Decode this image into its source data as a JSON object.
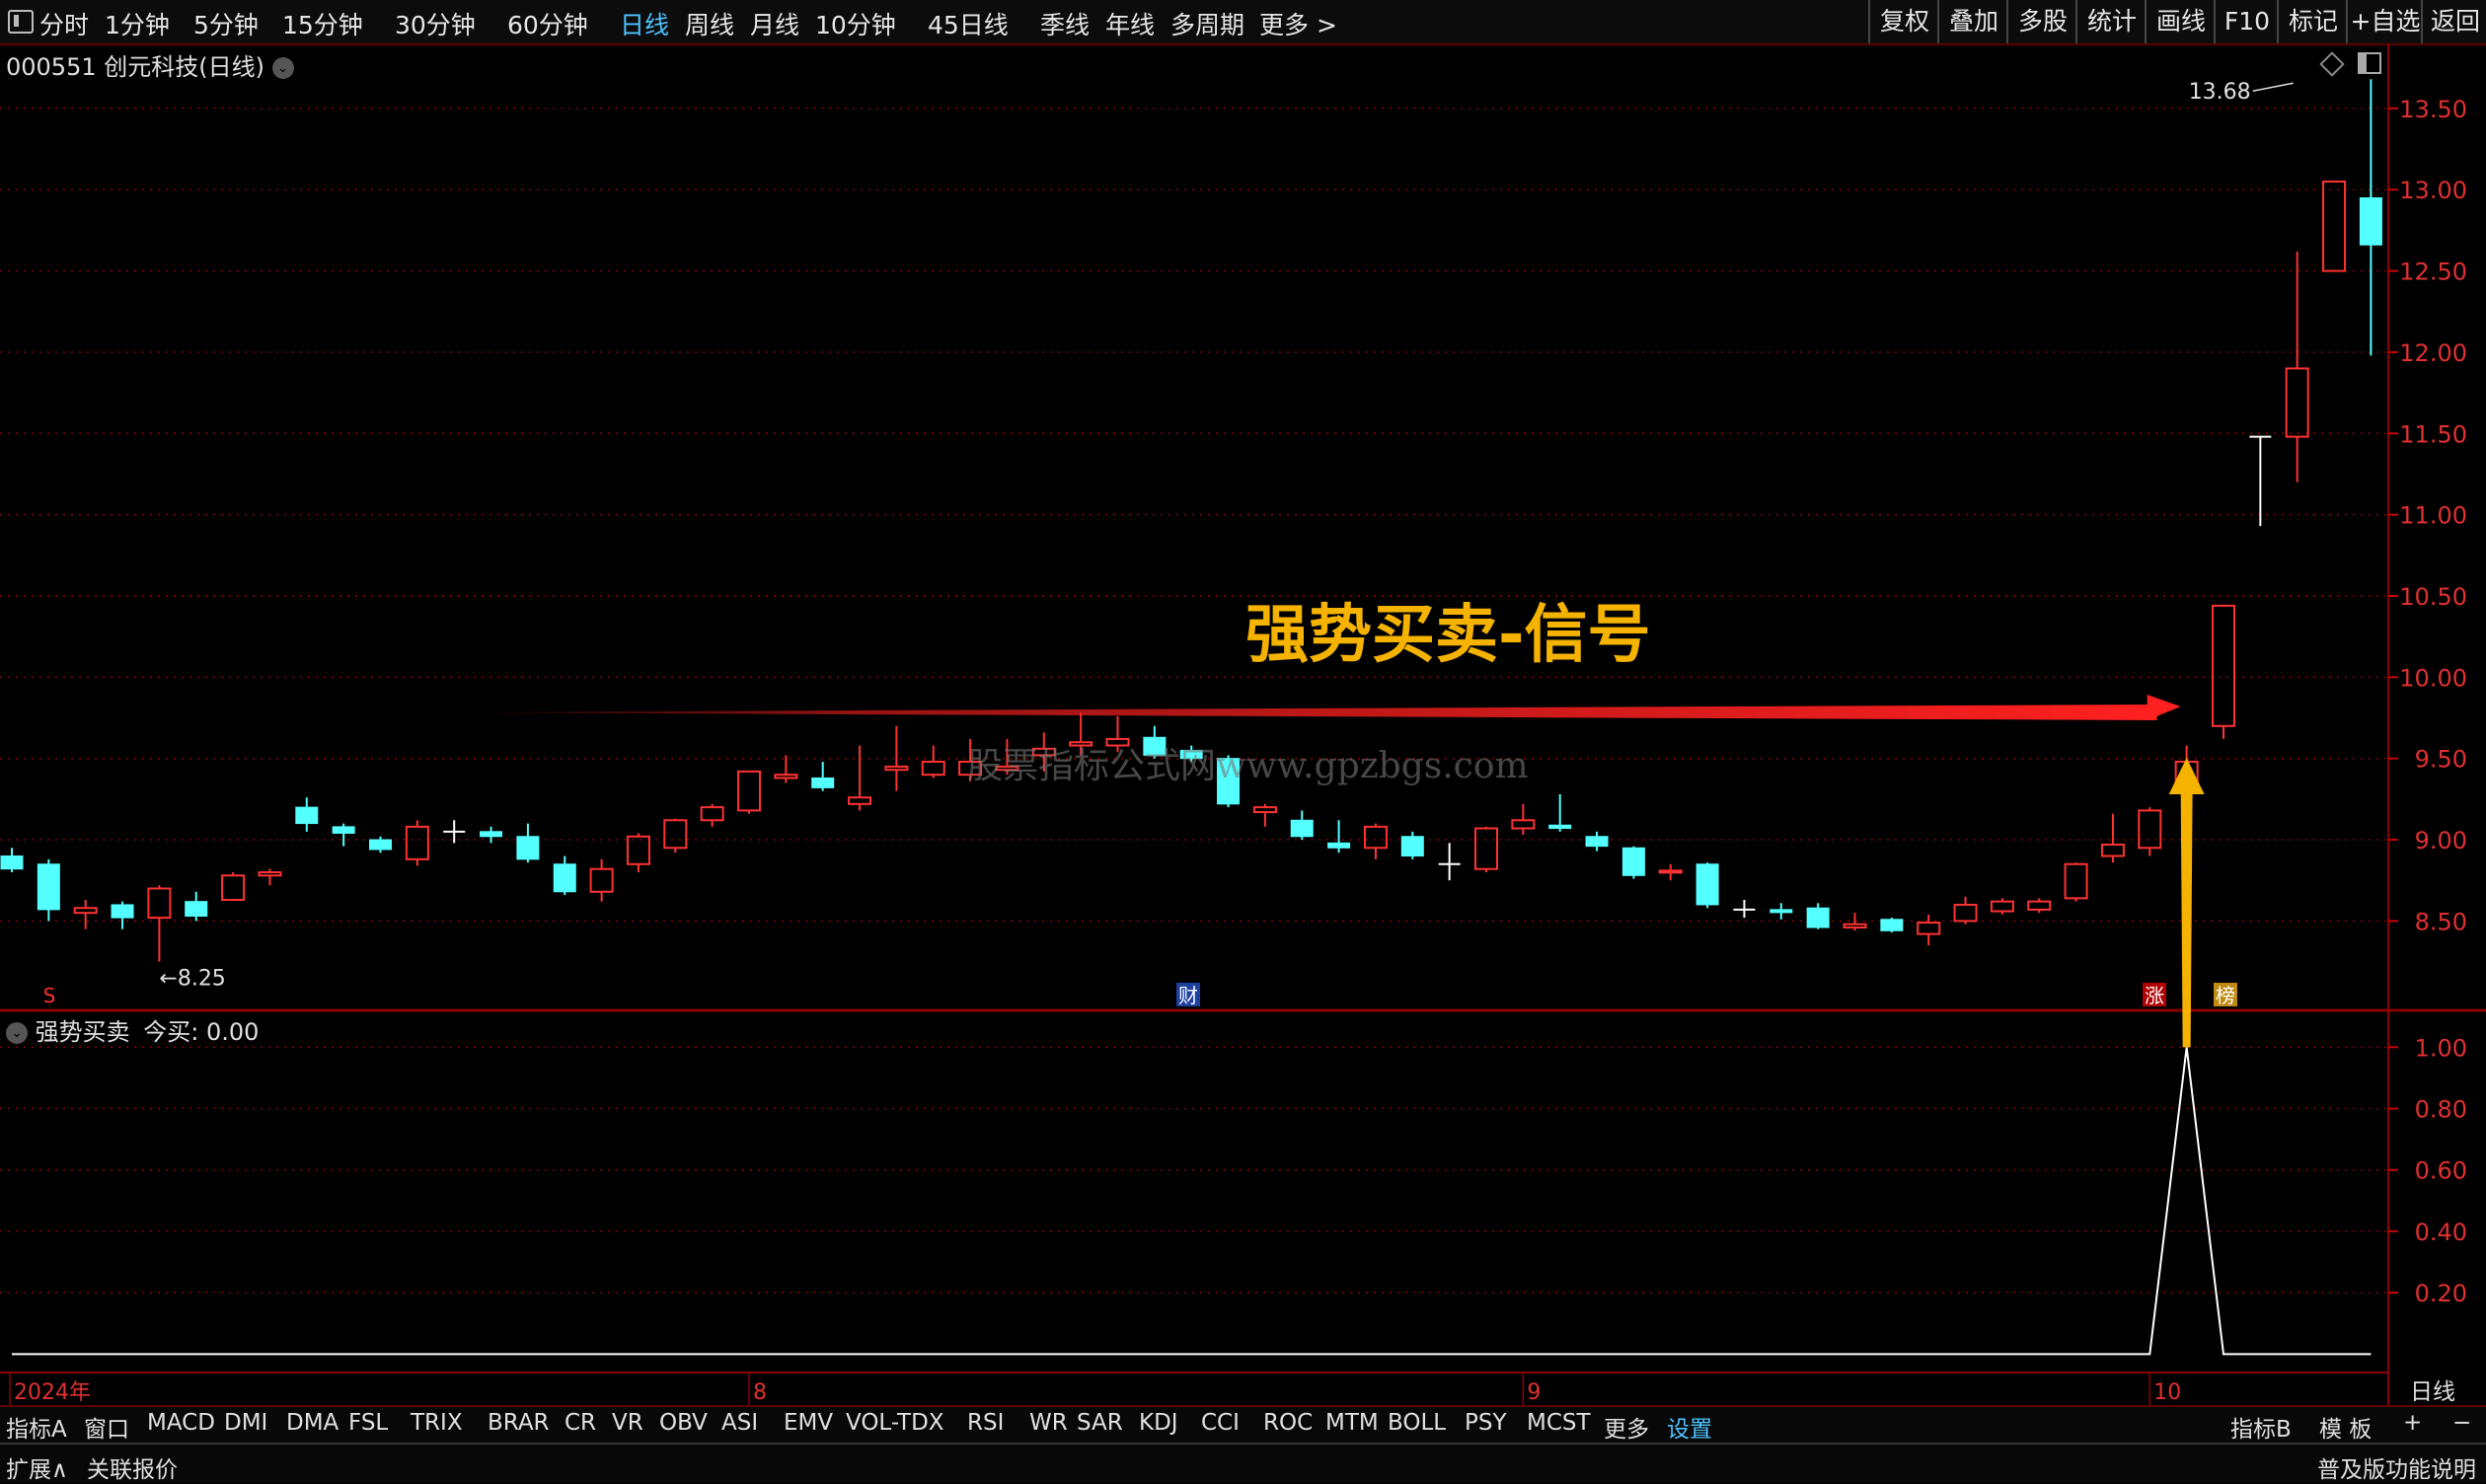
{
  "topbar": {
    "periods": [
      "分时",
      "1分钟",
      "5分钟",
      "15分钟",
      "30分钟",
      "60分钟",
      "日线",
      "周线",
      "月线",
      "10分钟",
      "45日线",
      "季线",
      "年线",
      "多周期",
      "更多 >"
    ],
    "active": "日线",
    "right_buttons": [
      "复权",
      "叠加",
      "多股",
      "统计",
      "画线",
      "F10",
      "标记",
      "+自选",
      "返回"
    ]
  },
  "stock": {
    "code": "000551",
    "name": "创元科技",
    "period": "(日线)"
  },
  "annotation": {
    "text": "强势买卖-信号",
    "watermark": "股票指标公式网www.gpzbgs.com"
  },
  "markers": {
    "fin": "财",
    "zhang": "涨",
    "bang": "榜",
    "s": "S"
  },
  "indicator": {
    "name": "强势买卖",
    "label": "今买: 0.00"
  },
  "bottom_tabs": [
    "指标A",
    "窗口",
    "MACD",
    "DMI",
    "DMA",
    "FSL",
    "TRIX",
    "BRAR",
    "CR",
    "VR",
    "OBV",
    "ASI",
    "EMV",
    "VOL-TDX",
    "RSI",
    "WR",
    "SAR",
    "KDJ",
    "CCI",
    "ROC",
    "MTM",
    "BOLL",
    "PSY",
    "MCST",
    "更多",
    "设置"
  ],
  "bottom_right": [
    "指标B",
    "模 板",
    "+",
    "−"
  ],
  "status": {
    "left1": "扩展∧",
    "left2": "关联报价",
    "right": "普及版功能说明",
    "period_label": "日线"
  },
  "chart_data": [
    {
      "type": "candlestick",
      "title": "",
      "y_ticks": [
        8.5,
        9.0,
        9.5,
        10.0,
        10.5,
        11.0,
        11.5,
        12.0,
        12.5,
        13.0,
        13.5
      ],
      "ylim": [
        7.95,
        13.9
      ],
      "x_labels": [
        {
          "text": "2024年",
          "index": 0
        },
        {
          "text": "8",
          "index": 20
        },
        {
          "text": "9",
          "index": 41
        },
        {
          "text": "10",
          "index": 58
        }
      ],
      "low_label": {
        "text": "←8.25",
        "value": 8.25,
        "index": 4
      },
      "high_label": {
        "text": "13.68",
        "value": 13.68,
        "index": 62
      },
      "candles": [
        {
          "o": 8.9,
          "c": 8.82,
          "h": 8.95,
          "l": 8.8
        },
        {
          "o": 8.85,
          "c": 8.57,
          "h": 8.88,
          "l": 8.5
        },
        {
          "o": 8.55,
          "c": 8.58,
          "h": 8.63,
          "l": 8.45
        },
        {
          "o": 8.6,
          "c": 8.52,
          "h": 8.62,
          "l": 8.45
        },
        {
          "o": 8.52,
          "c": 8.7,
          "h": 8.72,
          "l": 8.25
        },
        {
          "o": 8.62,
          "c": 8.53,
          "h": 8.68,
          "l": 8.5
        },
        {
          "o": 8.63,
          "c": 8.78,
          "h": 8.8,
          "l": 8.63
        },
        {
          "o": 8.78,
          "c": 8.8,
          "h": 8.82,
          "l": 8.72
        },
        {
          "o": 9.2,
          "c": 9.1,
          "h": 9.26,
          "l": 9.05
        },
        {
          "o": 9.08,
          "c": 9.04,
          "h": 9.1,
          "l": 8.96
        },
        {
          "o": 9.0,
          "c": 8.94,
          "h": 9.02,
          "l": 8.92
        },
        {
          "o": 8.88,
          "c": 9.08,
          "h": 9.12,
          "l": 8.84
        },
        {
          "o": 9.05,
          "c": 9.05,
          "h": 9.12,
          "l": 8.98
        },
        {
          "o": 9.05,
          "c": 9.02,
          "h": 9.08,
          "l": 8.98
        },
        {
          "o": 9.02,
          "c": 8.88,
          "h": 9.1,
          "l": 8.86
        },
        {
          "o": 8.85,
          "c": 8.68,
          "h": 8.9,
          "l": 8.66
        },
        {
          "o": 8.68,
          "c": 8.82,
          "h": 8.88,
          "l": 8.62
        },
        {
          "o": 8.85,
          "c": 9.02,
          "h": 9.04,
          "l": 8.8
        },
        {
          "o": 8.95,
          "c": 9.12,
          "h": 9.13,
          "l": 8.92
        },
        {
          "o": 9.12,
          "c": 9.2,
          "h": 9.22,
          "l": 9.08
        },
        {
          "o": 9.18,
          "c": 9.42,
          "h": 9.42,
          "l": 9.16
        },
        {
          "o": 9.38,
          "c": 9.4,
          "h": 9.52,
          "l": 9.35
        },
        {
          "o": 9.38,
          "c": 9.32,
          "h": 9.48,
          "l": 9.3
        },
        {
          "o": 9.22,
          "c": 9.26,
          "h": 9.58,
          "l": 9.18
        },
        {
          "o": 9.43,
          "c": 9.45,
          "h": 9.7,
          "l": 9.3
        },
        {
          "o": 9.4,
          "c": 9.48,
          "h": 9.58,
          "l": 9.38
        },
        {
          "o": 9.4,
          "c": 9.48,
          "h": 9.62,
          "l": 9.36
        },
        {
          "o": 9.43,
          "c": 9.45,
          "h": 9.62,
          "l": 9.4
        },
        {
          "o": 9.52,
          "c": 9.56,
          "h": 9.66,
          "l": 9.42
        },
        {
          "o": 9.58,
          "c": 9.6,
          "h": 9.78,
          "l": 9.52
        },
        {
          "o": 9.58,
          "c": 9.62,
          "h": 9.76,
          "l": 9.54
        },
        {
          "o": 9.63,
          "c": 9.52,
          "h": 9.7,
          "l": 9.5
        },
        {
          "o": 9.55,
          "c": 9.5,
          "h": 9.58,
          "l": 9.48
        },
        {
          "o": 9.5,
          "c": 9.22,
          "h": 9.52,
          "l": 9.2
        },
        {
          "o": 9.17,
          "c": 9.2,
          "h": 9.22,
          "l": 9.08
        },
        {
          "o": 9.12,
          "c": 9.02,
          "h": 9.18,
          "l": 9.0
        },
        {
          "o": 8.98,
          "c": 8.95,
          "h": 9.12,
          "l": 8.92
        },
        {
          "o": 8.95,
          "c": 9.08,
          "h": 9.1,
          "l": 8.88
        },
        {
          "o": 9.02,
          "c": 8.9,
          "h": 9.05,
          "l": 8.88
        },
        {
          "o": 8.85,
          "c": 8.85,
          "h": 8.98,
          "l": 8.75
        },
        {
          "o": 8.82,
          "c": 9.07,
          "h": 9.08,
          "l": 8.8
        },
        {
          "o": 9.07,
          "c": 9.12,
          "h": 9.22,
          "l": 9.03
        },
        {
          "o": 9.09,
          "c": 9.07,
          "h": 9.28,
          "l": 9.05
        },
        {
          "o": 9.02,
          "c": 8.96,
          "h": 9.05,
          "l": 8.93
        },
        {
          "o": 8.95,
          "c": 8.78,
          "h": 8.96,
          "l": 8.76
        },
        {
          "o": 8.8,
          "c": 8.81,
          "h": 8.85,
          "l": 8.75
        },
        {
          "o": 8.85,
          "c": 8.6,
          "h": 8.86,
          "l": 8.58
        },
        {
          "o": 8.57,
          "c": 8.57,
          "h": 8.63,
          "l": 8.52
        },
        {
          "o": 8.57,
          "c": 8.56,
          "h": 8.61,
          "l": 8.51
        },
        {
          "o": 8.58,
          "c": 8.46,
          "h": 8.61,
          "l": 8.45
        },
        {
          "o": 8.46,
          "c": 8.48,
          "h": 8.55,
          "l": 8.44
        },
        {
          "o": 8.51,
          "c": 8.44,
          "h": 8.52,
          "l": 8.43
        },
        {
          "o": 8.42,
          "c": 8.49,
          "h": 8.54,
          "l": 8.35
        },
        {
          "o": 8.5,
          "c": 8.6,
          "h": 8.65,
          "l": 8.48
        },
        {
          "o": 8.56,
          "c": 8.62,
          "h": 8.64,
          "l": 8.54
        },
        {
          "o": 8.57,
          "c": 8.62,
          "h": 8.64,
          "l": 8.55
        },
        {
          "o": 8.64,
          "c": 8.85,
          "h": 8.86,
          "l": 8.62
        },
        {
          "o": 8.9,
          "c": 8.97,
          "h": 9.16,
          "l": 8.86
        },
        {
          "o": 8.95,
          "c": 9.18,
          "h": 9.2,
          "l": 8.9
        },
        {
          "o": 9.3,
          "c": 9.48,
          "h": 9.58,
          "l": 9.26
        },
        {
          "o": 9.7,
          "c": 10.44,
          "h": 10.44,
          "l": 9.62
        },
        {
          "o": 11.48,
          "c": 11.48,
          "h": 11.48,
          "l": 10.93
        },
        {
          "o": 11.48,
          "c": 11.9,
          "h": 12.62,
          "l": 11.2
        },
        {
          "o": 12.5,
          "c": 13.05,
          "h": 13.05,
          "l": 12.5
        },
        {
          "o": 12.95,
          "c": 12.66,
          "h": 13.68,
          "l": 11.98
        }
      ]
    },
    {
      "type": "line",
      "title": "",
      "series": [
        {
          "name": "强势买卖",
          "x_index": [
            0,
            58,
            59,
            60,
            64
          ],
          "values": [
            0,
            0,
            1.0,
            0,
            0
          ]
        }
      ],
      "y_ticks": [
        0.2,
        0.4,
        0.6,
        0.8,
        1.0
      ],
      "ylim": [
        -0.06,
        1.12
      ]
    }
  ]
}
